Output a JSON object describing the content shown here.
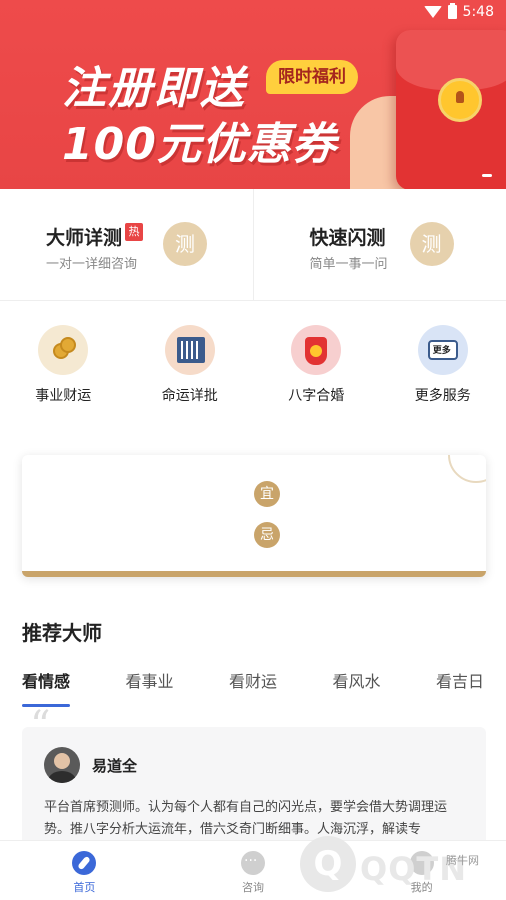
{
  "status_bar": {
    "time": "5:48"
  },
  "banner": {
    "line1": "注册即送",
    "tag": "限时福利",
    "line2": "100元优惠券"
  },
  "consult": [
    {
      "title": "大师详测",
      "badge": "热",
      "subtitle": "一对一详细咨询",
      "icon_text": "测"
    },
    {
      "title": "快速闪测",
      "subtitle": "简单一事一问",
      "icon_text": "测"
    }
  ],
  "services": [
    {
      "label": "事业财运",
      "icon": "coins-icon"
    },
    {
      "label": "命运详批",
      "icon": "book-icon"
    },
    {
      "label": "八字合婚",
      "icon": "lucky-bag-icon"
    },
    {
      "label": "更多服务",
      "icon": "scroll-icon"
    }
  ],
  "calendar": {
    "yi": "宜",
    "ji": "忌"
  },
  "recommend": {
    "title": "推荐大师",
    "tabs": [
      "看情感",
      "看事业",
      "看财运",
      "看风水",
      "看吉日"
    ],
    "active_tab": 0,
    "master": {
      "name": "易道全",
      "description": "平台首席预测师。认为每个人都有自己的闪光点，要学会借大势调理运势。推八字分析大运流年，借六爻奇门断细事。人海沉浮，解读专"
    }
  },
  "nav": [
    {
      "label": "首页",
      "icon": "home-compass-icon",
      "active": true
    },
    {
      "label": "咨询",
      "icon": "chat-icon",
      "active": false
    },
    {
      "label": "我的",
      "icon": "profile-icon",
      "active": false
    }
  ],
  "watermark": {
    "text": "QQTN",
    "small": "腾牛网"
  },
  "colors": {
    "accent": "#3b68d8",
    "banner": "#e84545",
    "gold": "#c9a46a"
  }
}
